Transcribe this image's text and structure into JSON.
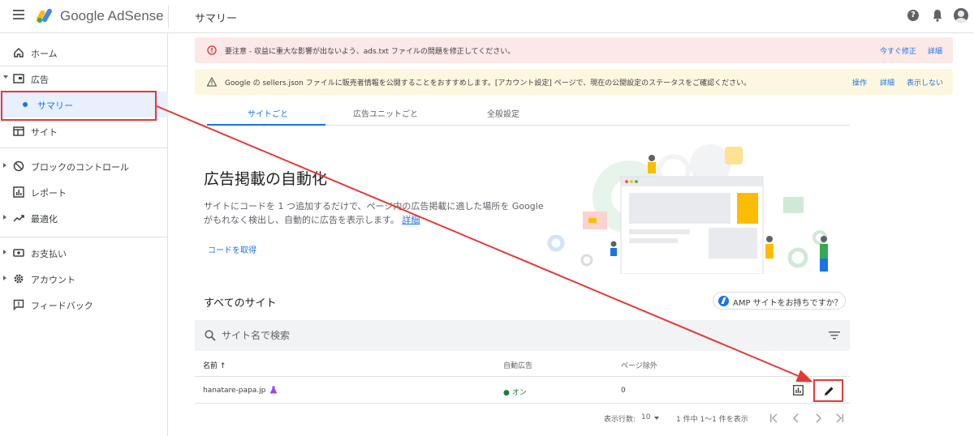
{
  "header": {
    "logo_text": "Google AdSense",
    "page_title": "サマリー",
    "help_glyph": "?"
  },
  "sidebar": {
    "items": [
      {
        "label": "ホーム",
        "icon": "home-icon"
      },
      {
        "label": "広告",
        "icon": "ads-icon"
      },
      {
        "label": "サマリー",
        "icon": "dot"
      },
      {
        "label": "サイト",
        "icon": "sites-icon"
      },
      {
        "label": "ブロックのコントロール",
        "icon": "block-icon"
      },
      {
        "label": "レポート",
        "icon": "report-icon"
      },
      {
        "label": "最適化",
        "icon": "optimize-icon"
      },
      {
        "label": "お支払い",
        "icon": "payment-icon"
      },
      {
        "label": "アカウント",
        "icon": "gear-icon"
      },
      {
        "label": "フィードバック",
        "icon": "feedback-icon"
      }
    ]
  },
  "alerts": {
    "error": {
      "text": "要注意 - 収益に重大な影響が出ないよう、ads.txt ファイルの問題を修正してください。",
      "actions": [
        "今すぐ修正",
        "詳細"
      ]
    },
    "warning": {
      "text": "Google の sellers.json ファイルに販売者情報を公開することをおすすめします。[アカウント設定] ページで、現在の公開設定のステータスをご確認ください。",
      "actions": [
        "操作",
        "詳細",
        "表示しない"
      ]
    }
  },
  "tabs": [
    "サイトごと",
    "広告ユニットごと",
    "全般設定"
  ],
  "auto_ads": {
    "title": "広告掲載の自動化",
    "description": "サイトにコードを 1 つ追加するだけで、ページ内の広告掲載に適した場所を Google がもれなく検出し、自動的に広告を表示します。",
    "learn_more": "詳細",
    "get_code": "コードを取得"
  },
  "sites": {
    "title": "すべてのサイト",
    "amp_chip": "AMP サイトをお持ちですか？",
    "search_placeholder": "サイト名で検索",
    "columns": [
      "名前 ↑",
      "自動広告",
      "ページ除外"
    ],
    "rows": [
      {
        "name": "hanatare-papa.jp",
        "auto_ads": "● オン",
        "excluded": "0"
      }
    ]
  },
  "pagination": {
    "rows_label": "表示行数:",
    "rows_value": "10",
    "range": "1 件中 1〜1 件を表示"
  },
  "colors": {
    "accent": "#1a73e8",
    "error_bg": "#fce8e6",
    "warning_bg": "#fef7e0",
    "annotation": "#e53935"
  }
}
